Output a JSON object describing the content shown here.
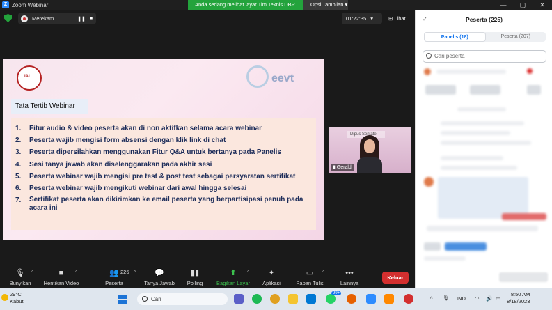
{
  "window": {
    "title": "Zoom Webinar",
    "share_banner": "Anda sedang melihat layar Tim Teknis DBP",
    "view_options": "Opsi Tampilan",
    "controls": [
      "—",
      "▢",
      "✕"
    ]
  },
  "meeting": {
    "recording_label": "Merekam...",
    "timer": "01:22:35",
    "view_label": "Lihat"
  },
  "slide": {
    "title": "Tata Tertib Webinar",
    "rules": [
      {
        "num": "1.",
        "text": "Fitur audio & video peserta akan di non aktifkan selama acara webinar"
      },
      {
        "num": "2.",
        "text": "Peserta wajib mengisi form absensi dengan klik link di chat"
      },
      {
        "num": "3.",
        "text": "Peserta dipersilahkan menggunakan Fitur Q&A untuk bertanya pada Panelis"
      },
      {
        "num": "4.",
        "text": "Sesi tanya jawab akan diselenggarakan pada akhir sesi"
      },
      {
        "num": "5.",
        "text": "Peserta webinar wajib mengisi pre test & post test sebagai persyaratan sertifikat"
      },
      {
        "num": "6.",
        "text": "Peserta webinar wajib mengikuti webinar dari awal hingga selesai"
      },
      {
        "num": "7.",
        "text": "Sertifikat peserta akan dikirimkan ke email peserta yang berpartisipasi penuh pada acara ini"
      }
    ],
    "logo_left_text": "IAI",
    "logo_right_text": "eevt"
  },
  "video": {
    "name": "Gerald",
    "banner": "Dipus Sentate"
  },
  "toolbar": {
    "unmute": "Bunyikan",
    "stop_video": "Hentikan Video",
    "participants": "Peserta",
    "participants_count": "225",
    "qa": "Tanya Jawab",
    "polling": "Polling",
    "share": "Bagikan Layar",
    "apps": "Aplikasi",
    "whiteboard": "Papan Tulis",
    "more": "Lainnya",
    "leave": "Keluar"
  },
  "panel": {
    "title": "Peserta (225)",
    "tab_panelists": "Panelis (18)",
    "tab_attendees": "Peserta (207)",
    "search_placeholder": "Cari peserta"
  },
  "taskbar": {
    "temperature": "29°C",
    "weather": "Kabut",
    "search": "Cari",
    "language": "IND",
    "time": "8:50 AM",
    "date": "8/18/2023",
    "badge": "99+"
  }
}
